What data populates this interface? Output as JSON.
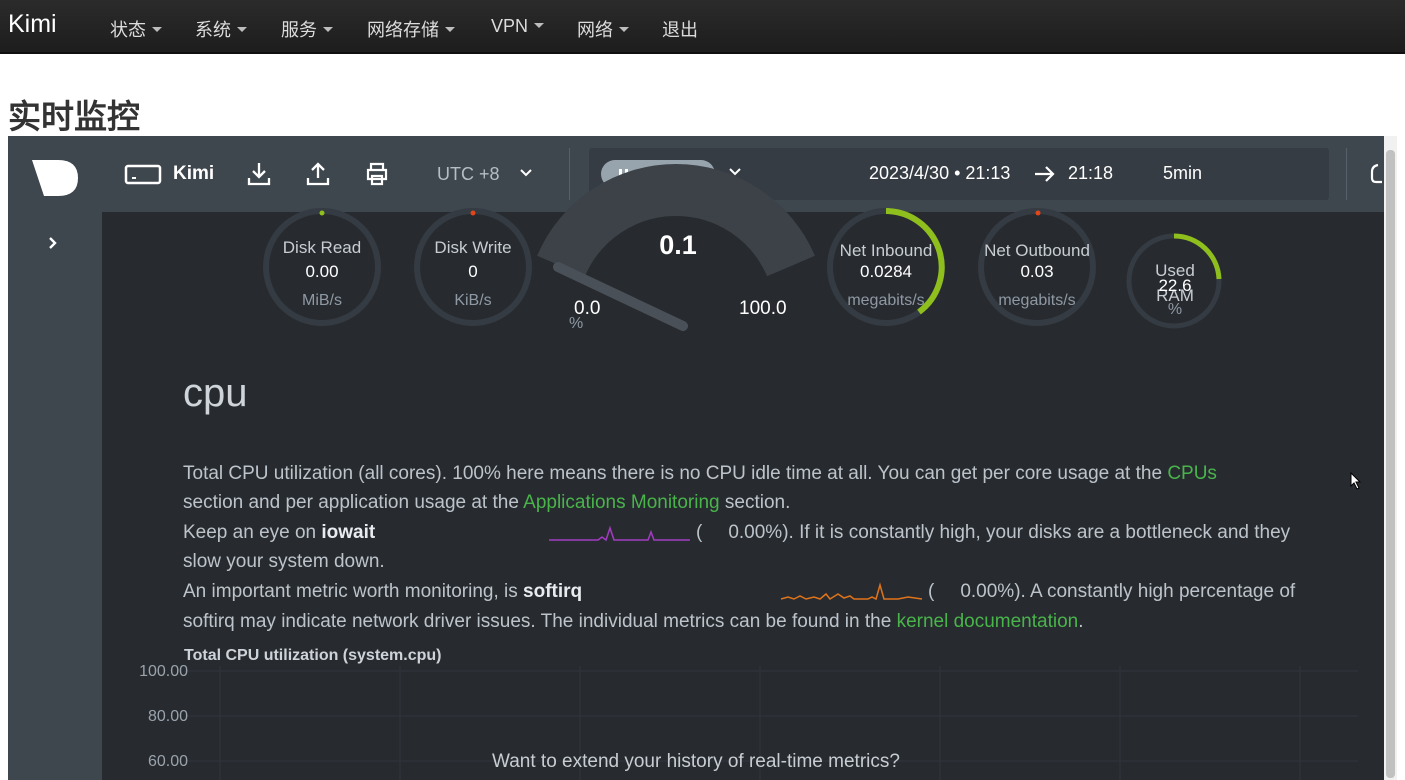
{
  "navbar": {
    "brand": "Kimi",
    "items": [
      {
        "label": "状态",
        "dropdown": true
      },
      {
        "label": "系统",
        "dropdown": true
      },
      {
        "label": "服务",
        "dropdown": true
      },
      {
        "label": "网络存储",
        "dropdown": true
      },
      {
        "label": "VPN",
        "dropdown": true
      },
      {
        "label": "网络",
        "dropdown": true
      },
      {
        "label": "退出",
        "dropdown": false
      }
    ]
  },
  "page": {
    "title": "实时监控"
  },
  "netdata": {
    "space_name": "Kimi",
    "icons": [
      "netdata-logo-icon",
      "monitor-icon",
      "download-icon",
      "upload-icon",
      "print-icon",
      "bell-icon"
    ],
    "timezone": "UTC +8",
    "status": "Paused",
    "date_from": "2023/4/30 • 21:13",
    "date_to": "21:18",
    "duration": "5min",
    "gauges": {
      "disk_read": {
        "title": "Disk Read",
        "value": "0.00",
        "unit": "MiB/s"
      },
      "disk_write": {
        "title": "Disk Write",
        "value": "0",
        "unit": "KiB/s"
      },
      "cpu": {
        "value": "0.1",
        "min": "0.0",
        "max": "100.0",
        "unit": "%",
        "level": 0.001
      },
      "net_inbound": {
        "title": "Net Inbound",
        "value": "0.0284",
        "unit": "megabits/s",
        "level": 0.55
      },
      "net_outbound": {
        "title": "Net Outbound",
        "value": "0.03",
        "unit": "megabits/s"
      },
      "used_ram": {
        "title": "Used RAM",
        "value": "22.6",
        "unit": "%",
        "level": 0.226
      }
    },
    "section": {
      "heading": "cpu",
      "p1_a": "Total CPU utilization (all cores). 100% here means there is no CPU idle time at all. You can get per core usage at the ",
      "p1_link1": "CPUs",
      "p1_b": "section and per application usage at the ",
      "p1_link2": "Applications Monitoring",
      "p1_c": " section.",
      "iowait_pre": "Keep an eye on ",
      "iowait_label": "iowait",
      "iowait_paren": "(",
      "iowait_value": "0.00%",
      "iowait_post": "). If it is constantly high, your disks are a bottleneck and they",
      "iowait_post2": "slow your system down.",
      "softirq_pre": "An important metric worth monitoring, is ",
      "softirq_label": "softirq",
      "softirq_paren": "(",
      "softirq_value": "0.00%",
      "softirq_post": "). A constantly high percentage of",
      "softirq_post2": "softirq may indicate network driver issues. The individual metrics can be found in the ",
      "softirq_link": "kernel documentation",
      "softirq_end": "."
    },
    "chart": {
      "title": "Total CPU utilization (system.cpu)",
      "yticks": [
        "100.00",
        "80.00",
        "60.00"
      ],
      "extend_message": "Want to extend your history of real-time metrics?"
    },
    "colors": {
      "accent_green": "#49b44a",
      "iowait_spark": "#a23cc2",
      "softirq_spark": "#e0731a",
      "gauge_arc": "#8fbf1d"
    }
  }
}
